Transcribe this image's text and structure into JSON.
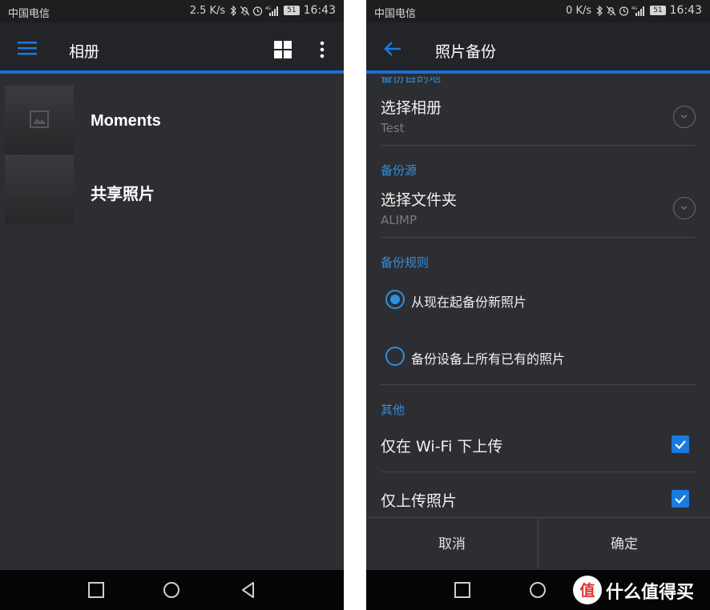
{
  "left": {
    "status": {
      "carrier": "中国电信",
      "speed": "2.5 K/s",
      "battery": "51",
      "time": "16:43"
    },
    "appbar": {
      "title": "相册"
    },
    "albums": [
      {
        "name": "Moments"
      },
      {
        "name": "共享照片"
      }
    ]
  },
  "right": {
    "status": {
      "carrier": "中国电信",
      "speed": "0 K/s",
      "battery": "51",
      "time": "16:43"
    },
    "appbar": {
      "title": "照片备份"
    },
    "sections": {
      "destination": "备份目的地",
      "source": "备份源",
      "rules": "备份规则",
      "other": "其他"
    },
    "album_row": {
      "title": "选择相册",
      "value": "Test"
    },
    "folder_row": {
      "title": "选择文件夹",
      "value": "ALIMP"
    },
    "rules": [
      {
        "label": "从现在起备份新照片",
        "selected": true
      },
      {
        "label": "备份设备上所有已有的照片",
        "selected": false
      }
    ],
    "options": [
      {
        "label": "仅在 Wi-Fi 下上传",
        "checked": true
      },
      {
        "label": "仅上传照片",
        "checked": true
      }
    ],
    "footer": {
      "cancel": "取消",
      "ok": "确定"
    }
  },
  "colors": {
    "accent": "#1a6fdb",
    "section": "#2f8fe0",
    "background": "#2d2e31"
  },
  "watermark": {
    "text": "什么值得买"
  }
}
